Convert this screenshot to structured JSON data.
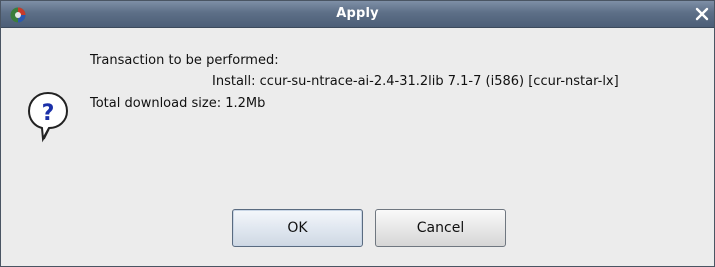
{
  "window": {
    "title": "Apply",
    "app_icon": "app-logo-icon",
    "close_icon": "close-icon"
  },
  "message": {
    "heading": "Transaction to be performed:",
    "install_line": "Install: ccur-su-ntrace-ai-2.4-31.2lib 7.1-7 (i586) [ccur-nstar-lx]",
    "download_size": "Total download size: 1.2Mb",
    "icon": "question-icon"
  },
  "buttons": {
    "ok_label": "OK",
    "cancel_label": "Cancel"
  },
  "colors": {
    "titlebar": "#5d6f87",
    "title_text": "#ffffff",
    "dialog_bg": "#ececec",
    "question_mark": "#1a2fa8"
  }
}
